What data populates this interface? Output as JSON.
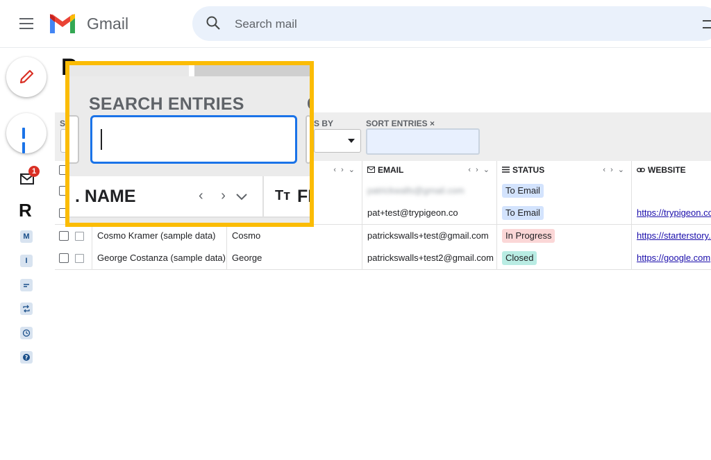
{
  "header": {
    "app_name": "Gmail",
    "search_placeholder": "Search mail"
  },
  "rail": {
    "mail_badge_count": "1",
    "shortcut_labels": [
      "M",
      "I"
    ]
  },
  "toolbar": {
    "search_label": "S",
    "sort_by_label": "S BY",
    "sort_entries_label": "SORT ENTRIES",
    "sort_entries_clear": "×"
  },
  "columns": [
    {
      "label": "",
      "icon": "arrows"
    },
    {
      "label": "EMAIL",
      "icon": "mail-icon"
    },
    {
      "label": "STATUS",
      "icon": "list-icon"
    },
    {
      "label": "WEBSITE",
      "icon": "link-icon"
    }
  ],
  "rows": [
    {
      "name": "",
      "first": "",
      "email": "patrickwalls@gmail.com",
      "email_blurred": true,
      "status": "To Email",
      "status_color": "#d3e3fd",
      "website": ""
    },
    {
      "name": "",
      "first": "",
      "email": "pat+test@trypigeon.co",
      "email_blurred": false,
      "status": "To Email",
      "status_color": "#d3e3fd",
      "website": "https://trypigeon.co"
    },
    {
      "name": "Cosmo Kramer (sample data)",
      "first": "Cosmo",
      "email": "patrickswalls+test@gmail.com",
      "email_blurred": false,
      "status": "In Progress",
      "status_color": "#fbd7d7",
      "website": "https://starterstory.com"
    },
    {
      "name": "George Costanza (sample data)",
      "first": "George",
      "email": "patrickswalls+test2@gmail.com",
      "email_blurred": false,
      "status": "Closed",
      "status_color": "#b9ece3",
      "website": "https://google.com"
    }
  ],
  "zoom": {
    "search_title": "SEARCH ENTRIES",
    "search_title_cut": "C",
    "search_value": "",
    "name_column": ". NAME",
    "name_arrows": "‹ ›",
    "next_column_cut": "FI",
    "text_type_icon": "Tт"
  },
  "colors": {
    "highlight_border": "#fbbc05",
    "focus_blue": "#1a73e8",
    "gmail_red": "#ea4335"
  }
}
